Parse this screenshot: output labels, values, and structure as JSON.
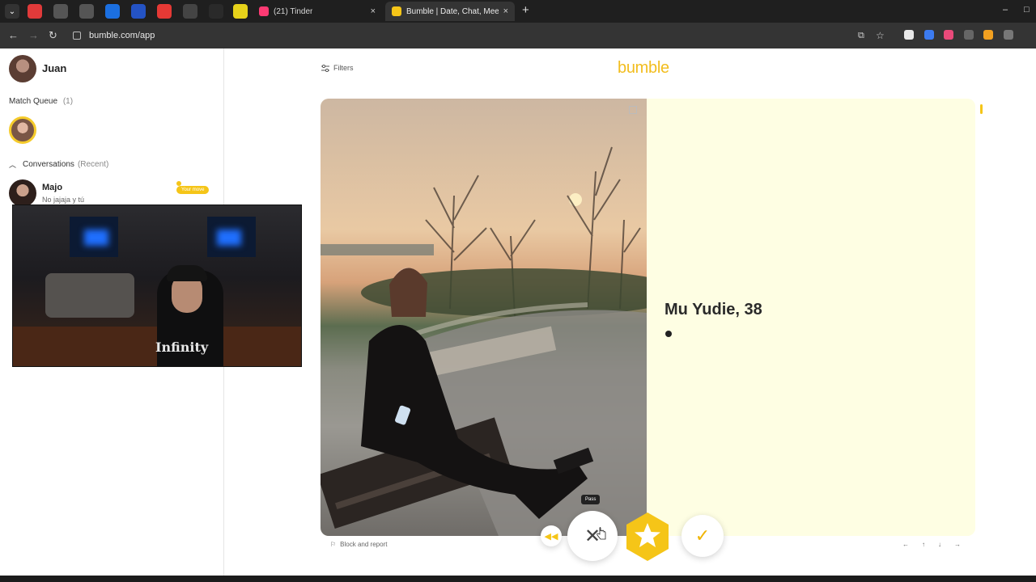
{
  "browser": {
    "tabs": [
      {
        "title": "(21) Tinder",
        "active": false,
        "favicon_color": "#fd3a73"
      },
      {
        "title": "Bumble | Date, Chat, Meet New",
        "active": true,
        "favicon_color": "#f5c518"
      }
    ],
    "url": "bumble.com/app",
    "new_tab": "+",
    "close_glyph": "×",
    "window_controls": [
      "–",
      "□"
    ]
  },
  "sidebar": {
    "user": {
      "name": "Juan"
    },
    "match_queue": {
      "label": "Match Queue",
      "count": "(1)"
    },
    "conversations": {
      "label": "Conversations",
      "sort": "(Recent)",
      "items": [
        {
          "name": "Majo",
          "preview": "No jajaja y tú",
          "badge": "Your move"
        }
      ]
    }
  },
  "webcam_overlay": {
    "shirt_text": "Infinity"
  },
  "main": {
    "filters_label": "Filters",
    "logo": "bumble",
    "profile": {
      "name_age": "Mu Yudie, 38"
    },
    "tooltip": "Pass",
    "block_report": "Block and report",
    "keyboard_hints": [
      "←",
      "↑",
      "↓",
      "→"
    ]
  },
  "colors": {
    "brand_yellow": "#f5c518",
    "card_bg": "#fefee3",
    "chrome_dark": "#1f1f1f"
  }
}
